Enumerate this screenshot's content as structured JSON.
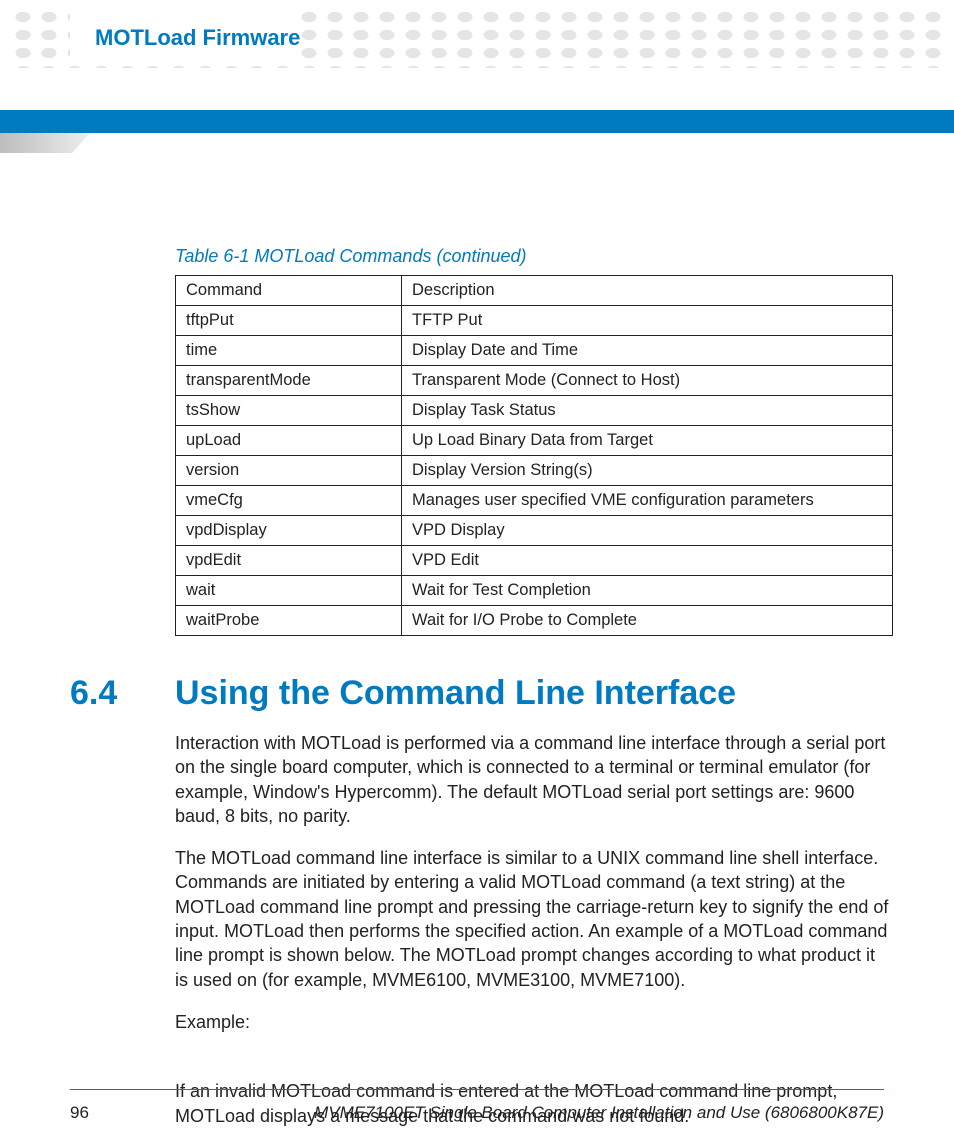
{
  "header": {
    "title": "MOTLoad Firmware"
  },
  "table": {
    "caption": "Table 6-1 MOTLoad Commands (continued)",
    "headers": [
      "Command",
      "Description"
    ],
    "rows": [
      [
        "tftpPut",
        "TFTP Put"
      ],
      [
        "time",
        "Display Date and Time"
      ],
      [
        "transparentMode",
        "Transparent Mode (Connect to Host)"
      ],
      [
        "tsShow",
        "Display Task Status"
      ],
      [
        "upLoad",
        "Up Load Binary Data from Target"
      ],
      [
        "version",
        "Display Version String(s)"
      ],
      [
        "vmeCfg",
        "Manages user specified VME configuration parameters"
      ],
      [
        "vpdDisplay",
        "VPD Display"
      ],
      [
        "vpdEdit",
        "VPD Edit"
      ],
      [
        "wait",
        "Wait for Test Completion"
      ],
      [
        "waitProbe",
        "Wait for I/O Probe to Complete"
      ]
    ]
  },
  "section": {
    "number": "6.4",
    "title": "Using the Command Line Interface",
    "p1": "Interaction with MOTLoad is performed via a command line interface through a serial port on the single board computer, which is connected to a terminal or terminal emulator (for example, Window's Hypercomm). The default MOTLoad serial port settings are: 9600 baud, 8 bits, no parity.",
    "p2": "The MOTLoad command line interface is similar to a UNIX command line shell interface. Commands are initiated by entering a valid MOTLoad command (a text string) at the MOTLoad command line prompt and pressing the carriage-return key to signify the end of input. MOTLoad then performs the specified action. An example of a MOTLoad command line prompt is shown below. The MOTLoad prompt changes according to what product it is used on (for example, MVME6100, MVME3100, MVME7100).",
    "example_label": "Example:",
    "p3": "If an invalid MOTLoad command is entered at the MOTLoad command line prompt, MOTLoad displays a message that the command was not found."
  },
  "footer": {
    "page": "96",
    "text": "MVME7100ET Single Board Computer Installation and Use (6806800K87E)"
  }
}
